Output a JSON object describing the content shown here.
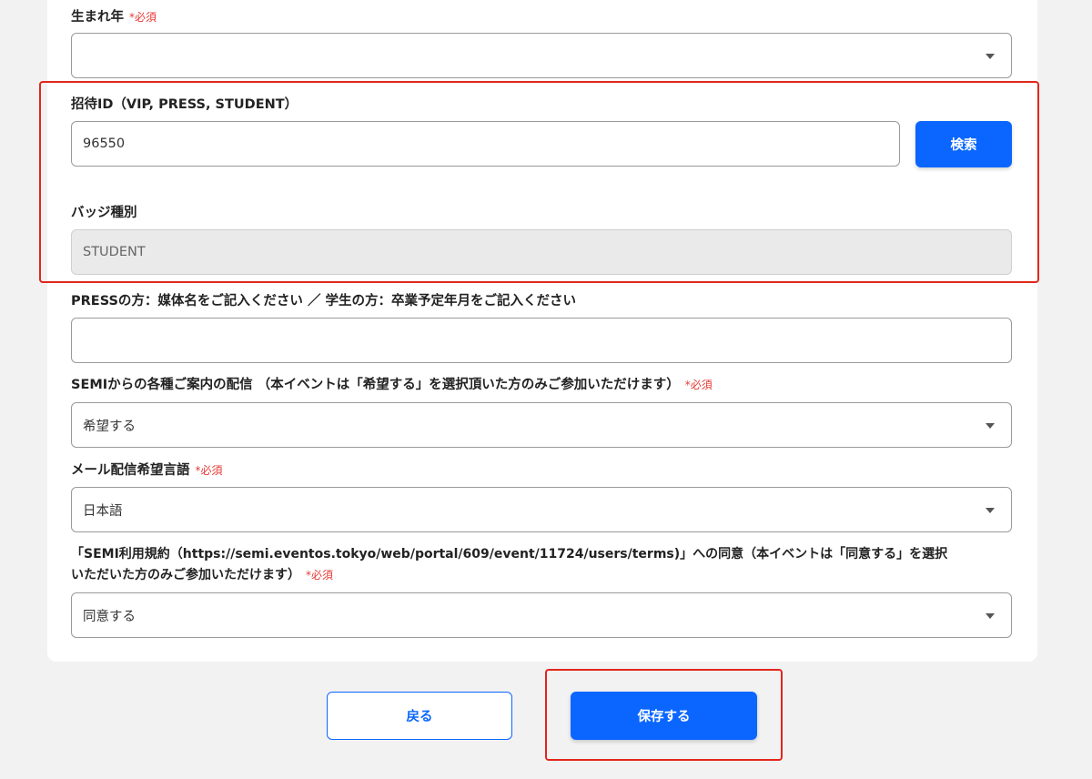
{
  "required_mark": "*必須",
  "birth_year": {
    "label": "生まれ年",
    "value": ""
  },
  "invite_id": {
    "label": "招待ID（VIP, PRESS, STUDENT）",
    "value": "96550",
    "search_label": "検索"
  },
  "badge_type": {
    "label": "バッジ種別",
    "value": "STUDENT"
  },
  "press_student": {
    "label": "PRESSの方：媒体名をご記入ください ／ 学生の方：卒業予定年月をご記入ください",
    "value": ""
  },
  "semi_info": {
    "label": "SEMIからの各種ご案内の配信 （本イベントは「希望する」を選択頂いた方のみご参加いただけます）",
    "value": "希望する"
  },
  "mail_language": {
    "label": "メール配信希望言語",
    "value": "日本語"
  },
  "terms": {
    "label_line1": "「SEMI利用規約（https://semi.eventos.tokyo/web/portal/609/event/11724/users/terms)」への同意（本イベントは「同意する」を選択",
    "label_line2": "いただいた方のみご参加いただけます）",
    "value": "同意する"
  },
  "buttons": {
    "back": "戻る",
    "save": "保存する"
  },
  "colors": {
    "primary": "#0a66ff",
    "highlight": "#e2261c",
    "required": "#e53935"
  }
}
